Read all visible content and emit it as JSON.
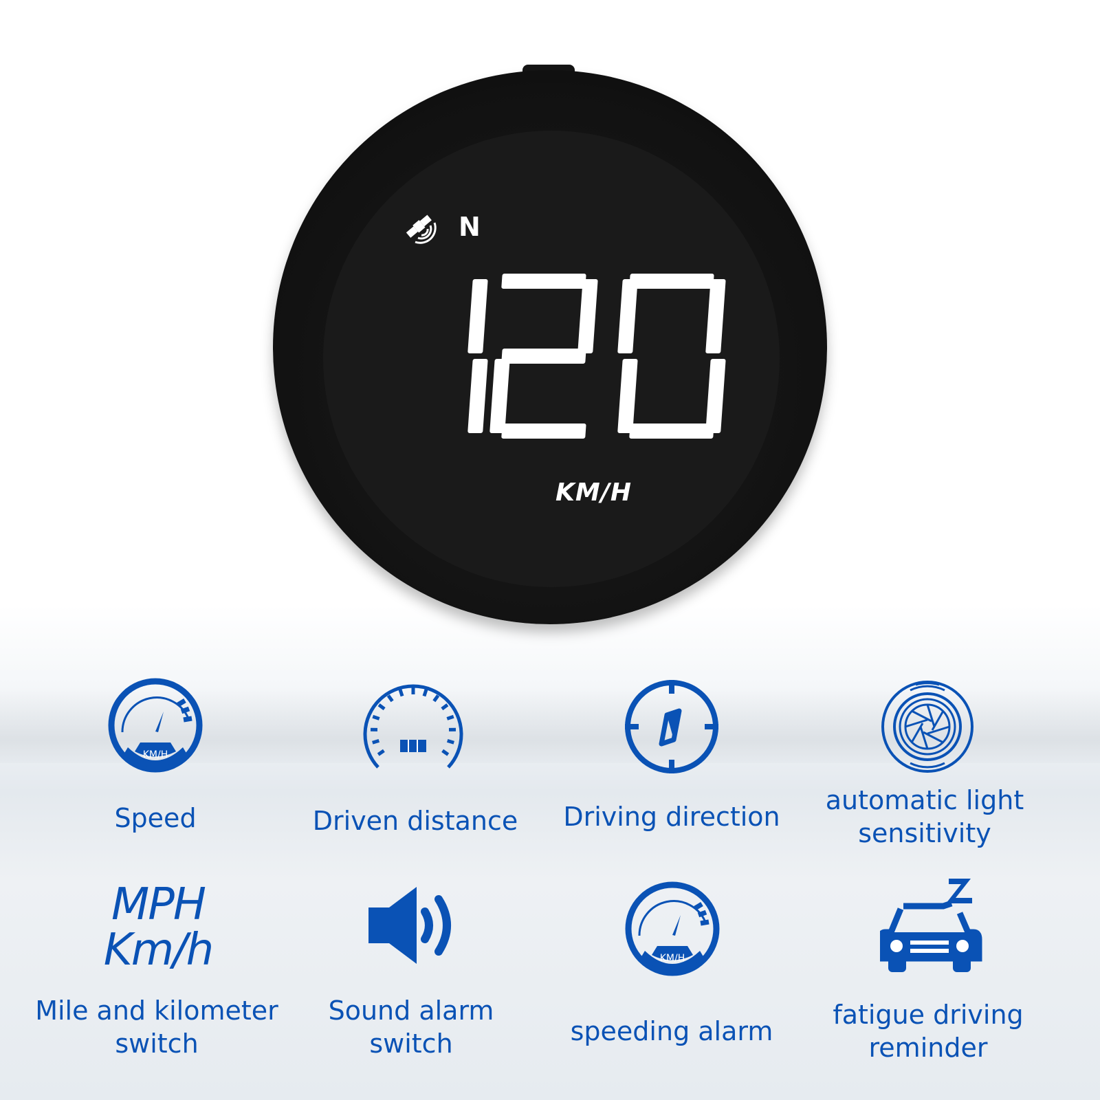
{
  "display": {
    "speed": "120",
    "direction": "N",
    "unit": "KM/H"
  },
  "accent_color": "#0a52b5",
  "features": [
    {
      "icon": "speedometer-icon",
      "label": "Speed",
      "gauge_text": "KM/H"
    },
    {
      "icon": "odometer-icon",
      "label": "Driven distance"
    },
    {
      "icon": "compass-icon",
      "label": "Driving direction"
    },
    {
      "icon": "light-sensor-icon",
      "label": "automatic light sensitivity"
    },
    {
      "icon": "unit-switch-icon",
      "label": "Mile and kilometer switch",
      "text1": "MPH",
      "text2": "Km/h"
    },
    {
      "icon": "speaker-icon",
      "label": "Sound alarm switch"
    },
    {
      "icon": "speedometer-icon",
      "label": "speeding alarm",
      "gauge_text": "KM/H"
    },
    {
      "icon": "car-sleep-icon",
      "label": "fatigue driving reminder"
    }
  ]
}
